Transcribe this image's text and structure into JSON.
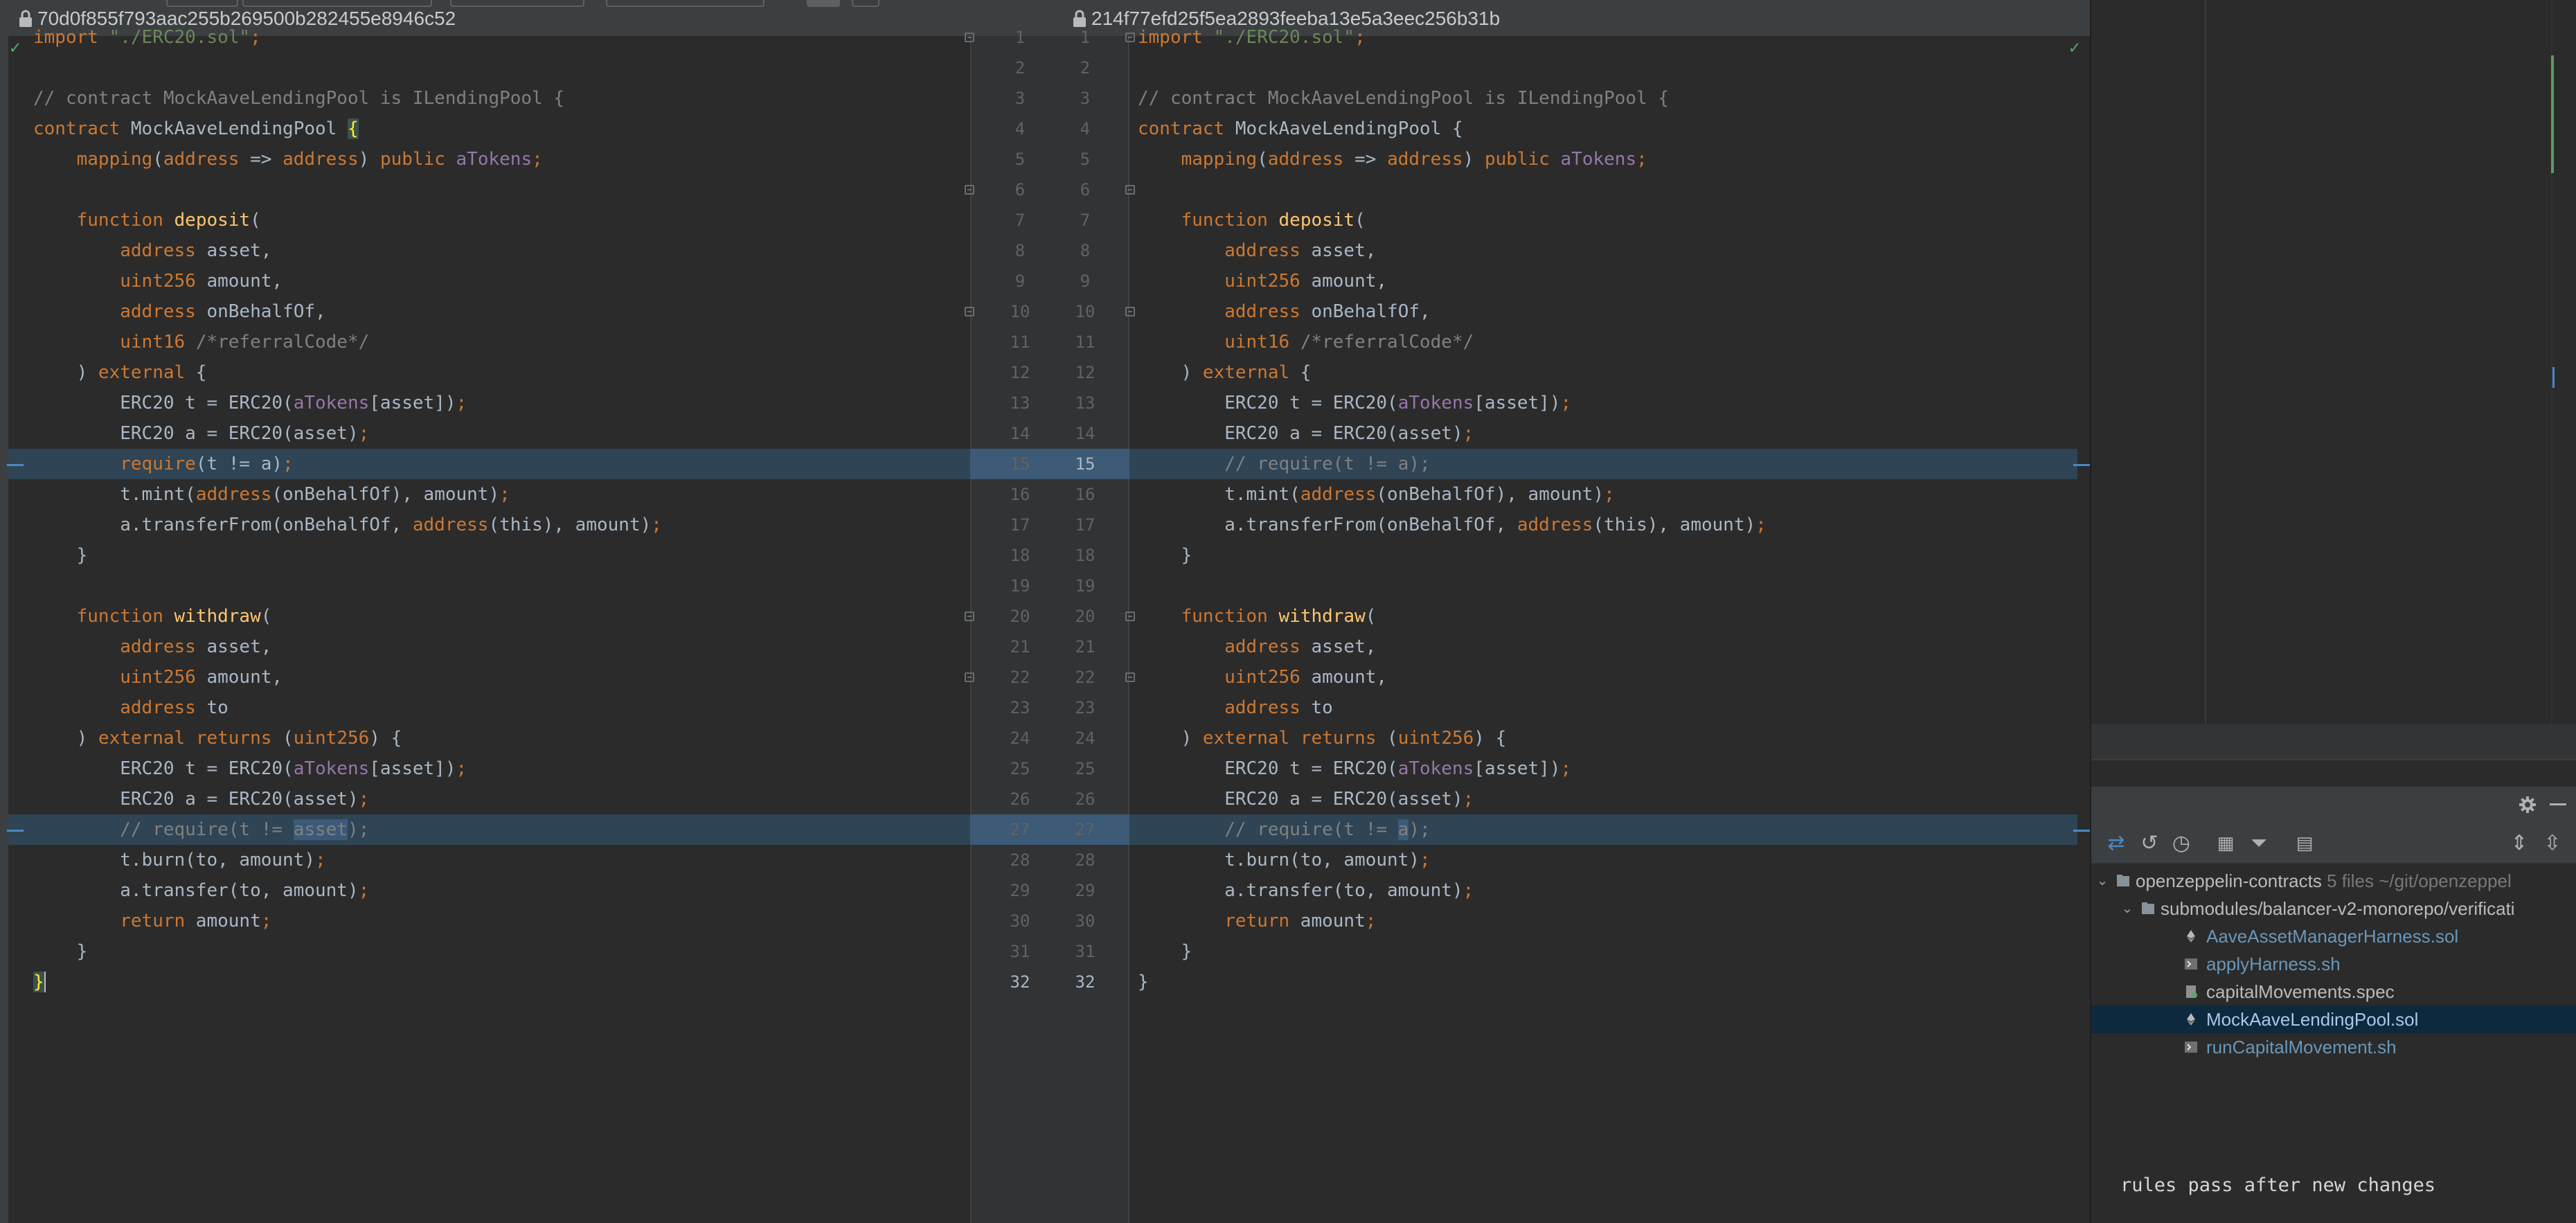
{
  "header": {
    "left_revision": "70d0f855f793aac255b269500b282455e8946c52",
    "right_revision": "214f77efd25f5ea2893feeba13e5a3eec256b31b"
  },
  "icons": [
    "lock-icon",
    "check-icon",
    "fold-icon",
    "gear-icon",
    "minimize-icon",
    "diff-icon",
    "rollback-icon",
    "history-icon",
    "group-by-icon",
    "filter-icon",
    "commit-icon",
    "expand-all-icon",
    "collapse-all-icon",
    "folder-icon",
    "solidity-file-icon",
    "shell-script-icon",
    "spec-file-icon"
  ],
  "colors": {
    "keyword": "#cc7832",
    "string": "#6a8759",
    "comment": "#808080",
    "function": "#ffc66d",
    "field": "#9876aa",
    "changed_line": "#2f4454",
    "selected_row": "#0d293e"
  },
  "left_code": [
    "import \"./ERC20.sol\";",
    "",
    "// contract MockAaveLendingPool is ILendingPool {",
    "contract MockAaveLendingPool {",
    "    mapping(address => address) public aTokens;",
    "",
    "    function deposit(",
    "        address asset,",
    "        uint256 amount,",
    "        address onBehalfOf,",
    "        uint16 /*referralCode*/",
    "    ) external {",
    "        ERC20 t = ERC20(aTokens[asset]);",
    "        ERC20 a = ERC20(asset);",
    "        require(t != a);",
    "        t.mint(address(onBehalfOf), amount);",
    "        a.transferFrom(onBehalfOf, address(this), amount);",
    "    }",
    "",
    "    function withdraw(",
    "        address asset,",
    "        uint256 amount,",
    "        address to",
    "    ) external returns (uint256) {",
    "        ERC20 t = ERC20(aTokens[asset]);",
    "        ERC20 a = ERC20(asset);",
    "        // require(t != asset);",
    "        t.burn(to, amount);",
    "        a.transfer(to, amount);",
    "        return amount;",
    "    }",
    "}"
  ],
  "right_code": [
    "import \"./ERC20.sol\";",
    "",
    "// contract MockAaveLendingPool is ILendingPool {",
    "contract MockAaveLendingPool {",
    "    mapping(address => address) public aTokens;",
    "",
    "    function deposit(",
    "        address asset,",
    "        uint256 amount,",
    "        address onBehalfOf,",
    "        uint16 /*referralCode*/",
    "    ) external {",
    "        ERC20 t = ERC20(aTokens[asset]);",
    "        ERC20 a = ERC20(asset);",
    "        // require(t != a);",
    "        t.mint(address(onBehalfOf), amount);",
    "        a.transferFrom(onBehalfOf, address(this), amount);",
    "    }",
    "",
    "    function withdraw(",
    "        address asset,",
    "        uint256 amount,",
    "        address to",
    "    ) external returns (uint256) {",
    "        ERC20 t = ERC20(aTokens[asset]);",
    "        ERC20 a = ERC20(asset);",
    "        // require(t != a);",
    "        t.burn(to, amount);",
    "        a.transfer(to, amount);",
    "        return amount;",
    "    }",
    "}"
  ],
  "line_numbers": [
    "1",
    "2",
    "3",
    "4",
    "5",
    "6",
    "7",
    "8",
    "9",
    "10",
    "11",
    "12",
    "13",
    "14",
    "15",
    "16",
    "17",
    "18",
    "19",
    "20",
    "21",
    "22",
    "23",
    "24",
    "25",
    "26",
    "27",
    "28",
    "29",
    "30",
    "31",
    "32"
  ],
  "changed_lines": [
    15,
    27
  ],
  "vcs": {
    "root": {
      "name": "openzeppelin-contracts",
      "meta": "5 files ~/git/openzeppel"
    },
    "folder": "submodules/balancer-v2-monorepo/verificati",
    "files": [
      {
        "name": "AaveAssetManagerHarness.sol",
        "icon": "solidity-file-icon"
      },
      {
        "name": "applyHarness.sh",
        "icon": "shell-script-icon"
      },
      {
        "name": "capitalMovements.spec",
        "icon": "spec-file-icon"
      },
      {
        "name": "MockAaveLendingPool.sol",
        "icon": "solidity-file-icon",
        "selected": true
      },
      {
        "name": "runCapitalMovement.sh",
        "icon": "shell-script-icon"
      }
    ],
    "commit_message": "rules pass after new changes"
  }
}
